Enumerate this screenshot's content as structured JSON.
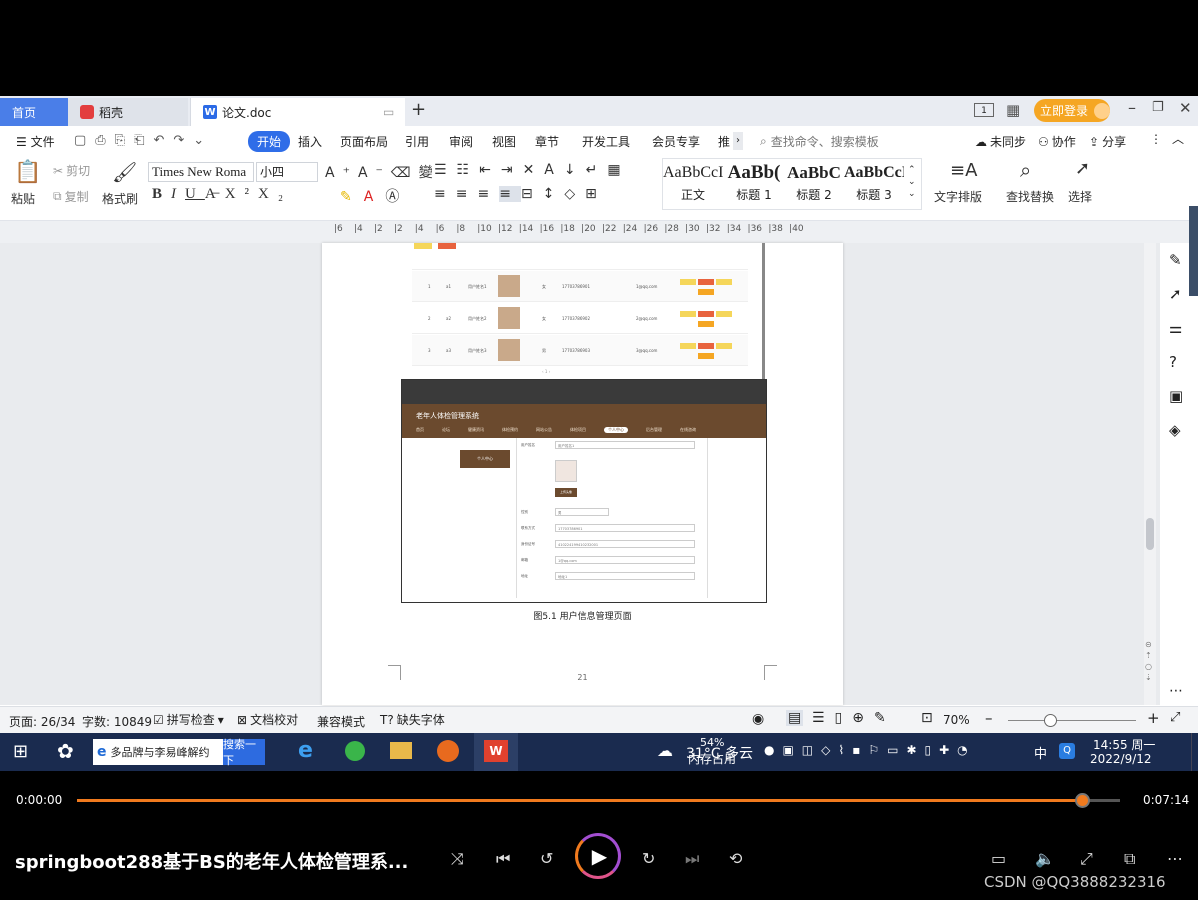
{
  "tabs": {
    "home": "首页",
    "daoke": "稻壳",
    "doc": "论文.doc"
  },
  "login_button": "立即登录",
  "menubar": {
    "file": "文件",
    "start": "开始",
    "insert": "插入",
    "layout": "页面布局",
    "reference": "引用",
    "review": "审阅",
    "view": "视图",
    "chapter": "章节",
    "devtools": "开发工具",
    "member": "会员专享",
    "recommend": "推",
    "search_placeholder": "查找命令、搜索模板",
    "unsynced": "未同步",
    "collab": "协作",
    "share": "分享"
  },
  "ribbon": {
    "paste": "粘贴",
    "cut": "剪切",
    "copy": "复制",
    "format_painter": "格式刷",
    "font_name": "Times New Roma",
    "font_size": "小四",
    "styles": [
      {
        "sample": "AaBbCcI",
        "label": "正文"
      },
      {
        "sample": "AaBb(",
        "label": "标题 1"
      },
      {
        "sample": "AaBbC",
        "label": "标题 2"
      },
      {
        "sample": "AaBbCcI",
        "label": "标题 3"
      }
    ],
    "text_layout": "文字排版",
    "find_replace": "查找替换",
    "select": "选择"
  },
  "ruler_ticks": [
    "6",
    "4",
    "2",
    "2",
    "4",
    "6",
    "8",
    "10",
    "12",
    "14",
    "16",
    "18",
    "20",
    "22",
    "24",
    "26",
    "28",
    "30",
    "32",
    "34",
    "36",
    "38",
    "40"
  ],
  "document": {
    "figure_caption": "图5.1  用户信息管理页面",
    "page_number": "21",
    "embedded_app_title": "老年人体检管理系统",
    "embedded_nav": [
      "首页",
      "论坛",
      "健康资讯",
      "体检预约",
      "网站公告",
      "体检项目",
      "个人中心",
      "后台管理",
      "在线咨询"
    ],
    "embedded_side_item": "个人中心",
    "embedded_form_labels": [
      "用户姓名",
      "性别",
      "联系方式",
      "身份证号",
      "邮箱",
      "地址"
    ],
    "embedded_form_values": [
      "用户姓名1",
      "男",
      "17703786901",
      "410224199410232001",
      "1@qq.com",
      "地址1"
    ],
    "embedded_upload_button": "上传头像",
    "embedded_table_rows": [
      {
        "idx": "1",
        "account": "a1",
        "name": "用户姓名1",
        "gender": "女",
        "phone": "17703786901",
        "email": "1@qq.com"
      },
      {
        "idx": "2",
        "account": "a2",
        "name": "用户姓名2",
        "gender": "女",
        "phone": "17703786902",
        "email": "2@qq.com"
      },
      {
        "idx": "3",
        "account": "a3",
        "name": "用户姓名3",
        "gender": "男",
        "phone": "17703786903",
        "email": "3@qq.com"
      }
    ]
  },
  "status": {
    "page": "页面: 26/34",
    "words": "字数: 10849",
    "spellcheck": "拼写检查",
    "doc_compare": "文档校对",
    "compat_mode": "兼容模式",
    "missing_fonts": "缺失字体",
    "zoom": "70%"
  },
  "taskbar": {
    "search_text": "多品牌与李易峰解约",
    "search_button": "搜索一下",
    "weather": "31°C 多云",
    "memory_pct": "54%",
    "memory_label": "内存占用",
    "ime": "中",
    "time": "14:55 周一",
    "date": "2022/9/12"
  },
  "player": {
    "current_time": "0:00:00",
    "total_time": "0:07:14",
    "progress_fraction": 0.965,
    "title": "springboot288基于BS的老年人体检管理系...",
    "watermark": "CSDN @QQ3888232316"
  },
  "colors": {
    "accent": "#2f6de8",
    "login": "#f5a623",
    "progress": "#f07a1e",
    "taskbar": "#1a2b4f"
  }
}
